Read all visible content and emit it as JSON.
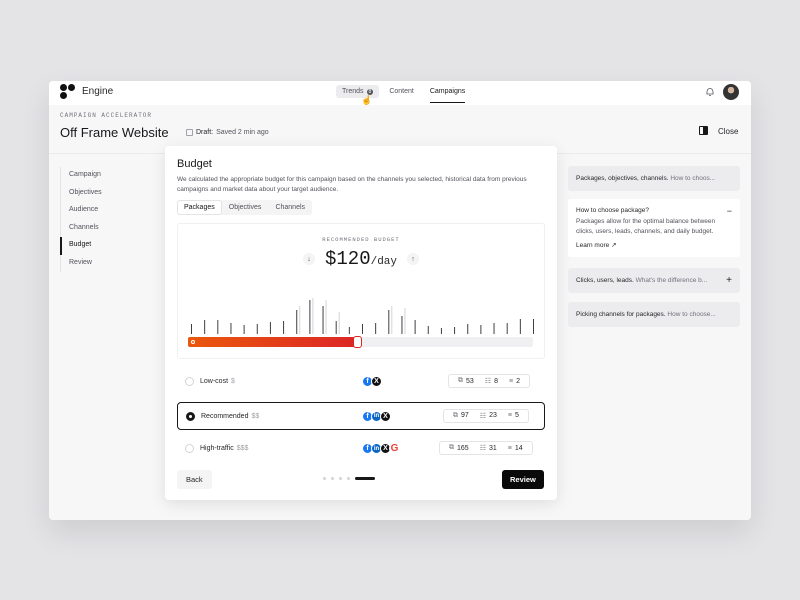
{
  "app": {
    "name": "Engine"
  },
  "nav": {
    "items": [
      {
        "label": "Trends",
        "badge": "8"
      },
      {
        "label": "Content"
      },
      {
        "label": "Campaigns"
      }
    ]
  },
  "header": {
    "eyebrow": "CAMPAIGN ACCELERATOR",
    "title": "Off Frame Website",
    "draft_label": "Draft:",
    "saved": "Saved 2 min ago",
    "close_label": "Close"
  },
  "steps": [
    "Campaign",
    "Objectives",
    "Audience",
    "Channels",
    "Budget",
    "Review"
  ],
  "budget": {
    "title": "Budget",
    "description": "We calculated the appropriate budget for this campaign based on the channels you selected, historical data from previous campaigns and market data about your target audience.",
    "tabs": [
      "Packages",
      "Objectives",
      "Channels"
    ],
    "recommended_label": "RECOMMENDED BUDGET",
    "amount": "$120",
    "per": "/day",
    "slider_value": 0.49,
    "histogram": [
      10,
      14,
      14,
      11,
      9,
      10,
      12,
      13,
      24,
      34,
      28,
      13,
      7,
      10,
      11,
      24,
      18,
      14,
      8,
      6,
      7,
      10,
      9,
      11,
      11,
      15,
      15
    ],
    "histogram_ghost": [
      0,
      0,
      0,
      0,
      0,
      0,
      0,
      0,
      28,
      36,
      34,
      22,
      0,
      0,
      0,
      28,
      26,
      0,
      0,
      0,
      0,
      0,
      0,
      0,
      0,
      0,
      0
    ]
  },
  "packages": [
    {
      "name": "Low-cost",
      "cost": "$",
      "channels": [
        "facebook-icon",
        "x-icon"
      ],
      "stats": [
        "53",
        "8",
        "2"
      ]
    },
    {
      "name": "Recommended",
      "cost": "$$",
      "channels": [
        "facebook-icon",
        "linkedin-icon",
        "x-icon"
      ],
      "stats": [
        "97",
        "23",
        "5"
      ],
      "selected": true
    },
    {
      "name": "High-traffic",
      "cost": "$$$",
      "channels": [
        "facebook-icon",
        "linkedin-icon",
        "x-icon",
        "google-icon"
      ],
      "stats": [
        "165",
        "31",
        "14"
      ]
    }
  ],
  "footer": {
    "back": "Back",
    "review": "Review",
    "pages": 5,
    "current": 4
  },
  "faq": [
    {
      "q": "Packages, objectives, channels.",
      "preview": "How to choos..."
    },
    {
      "q": "How to choose package?",
      "answer": "Packages allow for the optimal balance between clicks, users, leads, channels, and daily budget.",
      "link": "Learn more",
      "open": true
    },
    {
      "q": "Clicks, users, leads.",
      "preview": "What's the difference b..."
    },
    {
      "q": "Picking channels for packages.",
      "preview": "How to choose..."
    }
  ],
  "colors": {
    "accent_start": "#ea580c",
    "accent_end": "#dc2626",
    "primary": "#0a0a0a"
  }
}
